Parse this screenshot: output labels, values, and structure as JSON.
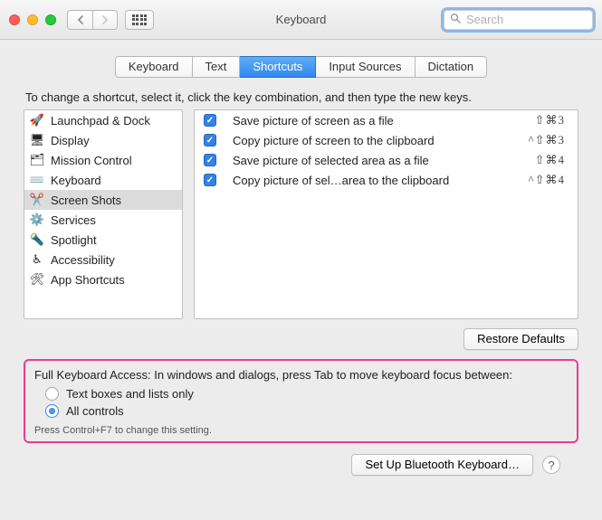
{
  "window": {
    "title": "Keyboard",
    "search_placeholder": "Search"
  },
  "tabs": [
    {
      "label": "Keyboard",
      "active": false
    },
    {
      "label": "Text",
      "active": false
    },
    {
      "label": "Shortcuts",
      "active": true
    },
    {
      "label": "Input Sources",
      "active": false
    },
    {
      "label": "Dictation",
      "active": false
    }
  ],
  "instruction": "To change a shortcut, select it, click the key combination, and then type the new keys.",
  "categories": [
    {
      "label": "Launchpad & Dock",
      "icon": "🚀",
      "selected": false
    },
    {
      "label": "Display",
      "icon": "🖥",
      "selected": false
    },
    {
      "label": "Mission Control",
      "icon": "🗂",
      "selected": false
    },
    {
      "label": "Keyboard",
      "icon": "⌨️",
      "selected": false
    },
    {
      "label": "Screen Shots",
      "icon": "✂️",
      "selected": true
    },
    {
      "label": "Services",
      "icon": "⚙️",
      "selected": false
    },
    {
      "label": "Spotlight",
      "icon": "🔦",
      "selected": false
    },
    {
      "label": "Accessibility",
      "icon": "♿︎",
      "selected": false
    },
    {
      "label": "App Shortcuts",
      "icon": "🛠",
      "selected": false
    }
  ],
  "shortcuts": [
    {
      "checked": true,
      "label": "Save picture of screen as a file",
      "combo": "⇧⌘3"
    },
    {
      "checked": true,
      "label": "Copy picture of screen to the clipboard",
      "combo": "^⇧⌘3"
    },
    {
      "checked": true,
      "label": "Save picture of selected area as a file",
      "combo": "⇧⌘4"
    },
    {
      "checked": true,
      "label": "Copy picture of sel…area to the clipboard",
      "combo": "^⇧⌘4"
    }
  ],
  "buttons": {
    "restore_defaults": "Restore Defaults",
    "setup_bluetooth": "Set Up Bluetooth Keyboard…"
  },
  "fka": {
    "title": "Full Keyboard Access: In windows and dialogs, press Tab to move keyboard focus between:",
    "option_text": "Text boxes and lists only",
    "option_all": "All controls",
    "selected": "all",
    "hint": "Press Control+F7 to change this setting."
  }
}
